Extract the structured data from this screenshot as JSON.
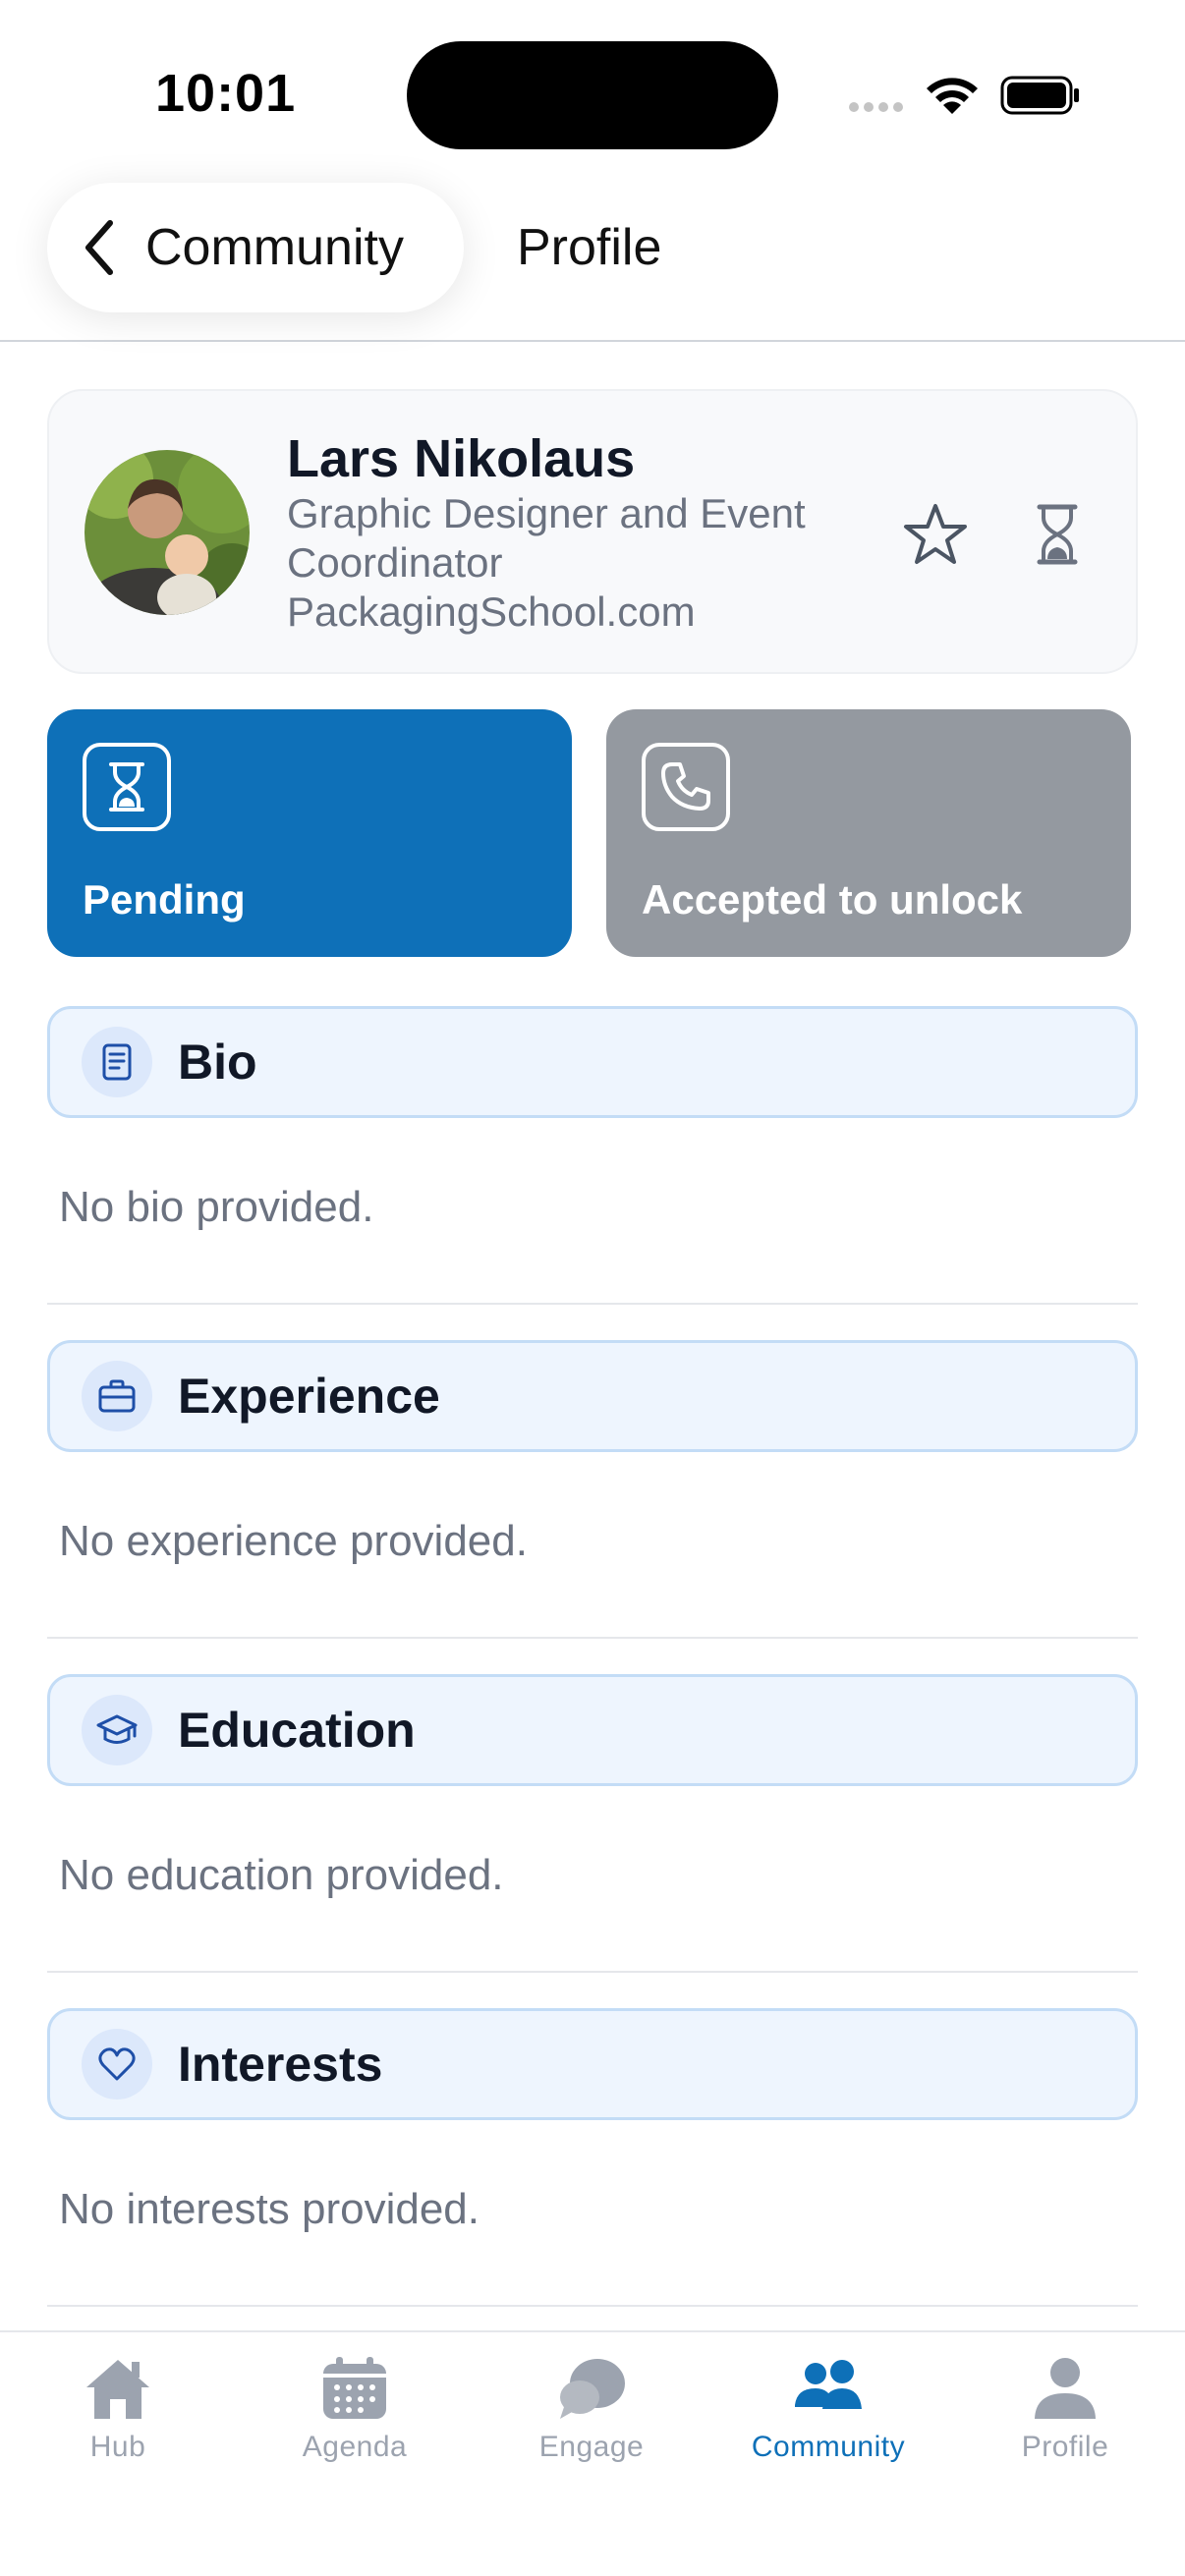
{
  "status_bar": {
    "time": "10:01"
  },
  "header": {
    "back_label": "Community",
    "title": "Profile"
  },
  "profile": {
    "name": "Lars Nikolaus",
    "role": "Graphic Designer and Event Coordinator",
    "company": "PackagingSchool.com"
  },
  "actions": [
    {
      "label": "Pending",
      "icon": "hourglass-icon",
      "color": "#0e70b8"
    },
    {
      "label": "Accepted to unlock",
      "icon": "phone-icon",
      "color": "#9499a0"
    }
  ],
  "sections": [
    {
      "title": "Bio",
      "icon": "document-icon",
      "body": "No bio provided."
    },
    {
      "title": "Experience",
      "icon": "briefcase-icon",
      "body": "No experience provided."
    },
    {
      "title": "Education",
      "icon": "graduation-cap-icon",
      "body": "No education provided."
    },
    {
      "title": "Interests",
      "icon": "heart-icon",
      "body": "No interests provided."
    }
  ],
  "tabs": [
    {
      "label": "Hub",
      "icon": "home-icon",
      "active": false
    },
    {
      "label": "Agenda",
      "icon": "calendar-icon",
      "active": false
    },
    {
      "label": "Engage",
      "icon": "chat-bubbles-icon",
      "active": false
    },
    {
      "label": "Community",
      "icon": "people-icon",
      "active": true
    },
    {
      "label": "Profile",
      "icon": "person-icon",
      "active": false
    }
  ],
  "colors": {
    "accent": "#0e70b8",
    "inactive_tile": "#9499a0",
    "section_bg": "#eef5fe",
    "section_border": "#c3dcf6",
    "muted_text": "#6b7280"
  }
}
